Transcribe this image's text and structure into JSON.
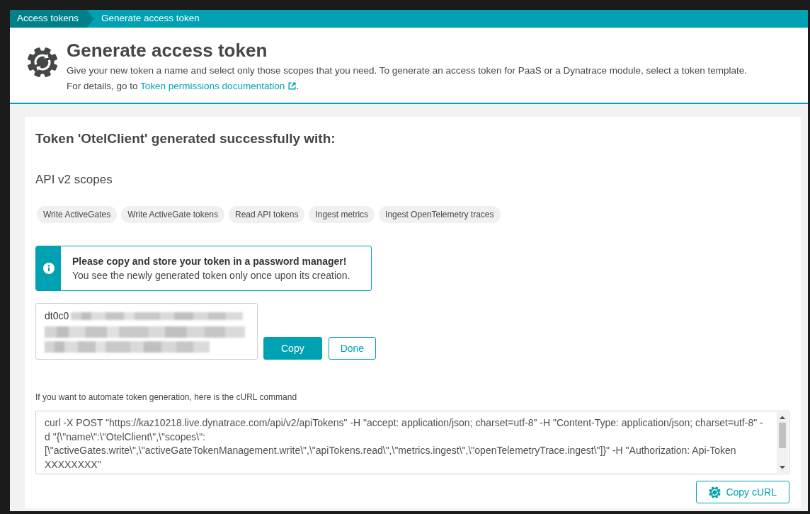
{
  "breadcrumbs": [
    {
      "label": "Access tokens",
      "current": false
    },
    {
      "label": "Generate access token",
      "current": true
    }
  ],
  "header": {
    "title": "Generate access token",
    "description": "Give your new token a name and select only those scopes that you need. To generate an access token for PaaS or a Dynatrace module, select a token template.",
    "details_text": "For details, go to",
    "details_link": "Token permissions documentation",
    "details_suffix": "."
  },
  "result": {
    "title": "Token 'OtelClient' generated successfully with:",
    "scope_group": "API v2 scopes",
    "scopes": [
      "Write ActiveGates",
      "Write ActiveGate tokens",
      "Read API tokens",
      "Ingest metrics",
      "Ingest OpenTelemetry traces"
    ],
    "alert": {
      "kind": "info",
      "title": "Please copy and store your token in a password manager!",
      "message": "You see the newly generated token only once upon its creation."
    },
    "token_field": {
      "value": "dt0c0"
    },
    "buttons": [
      {
        "label": "Copy",
        "kind": "primary"
      },
      {
        "label": "Done",
        "kind": "secondary"
      }
    ],
    "curl_hint": "If you want to automate token generation, here is the cURL command",
    "curl_command": "curl -X POST \"https://kaz10218.live.dynatrace.com/api/v2/apiTokens\" -H \"accept: application/json; charset=utf-8\" -H \"Content-Type: application/json; charset=utf-8\" -d \"{\\\"name\\\":\\\"OtelClient\\\",\\\"scopes\\\":[\\\"activeGates.write\\\",\\\"activeGateTokenManagement.write\\\",\\\"apiTokens.read\\\",\\\"metrics.ingest\\\",\\\"openTelemetryTrace.ingest\\\"]}\" -H \"Authorization: Api-Token XXXXXXXX\"",
    "copy_curl_button": {
      "label": "Copy cURL"
    }
  }
}
